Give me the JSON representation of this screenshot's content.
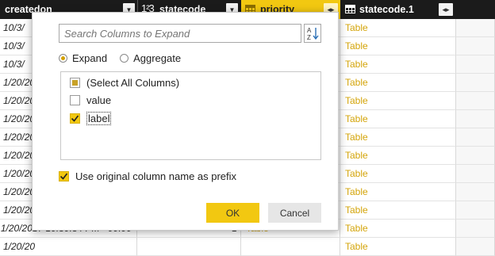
{
  "columns": {
    "createdon": "createdon",
    "statecode_type": "1²3",
    "statecode": "statecode",
    "priority": "priority",
    "statecode1": "statecode.1"
  },
  "rows": [
    {
      "date": "10/3/",
      "state": "",
      "priority": "",
      "statecode1": "Table"
    },
    {
      "date": "10/3/",
      "state": "",
      "priority": "",
      "statecode1": "Table"
    },
    {
      "date": "10/3/",
      "state": "",
      "priority": "",
      "statecode1": "Table"
    },
    {
      "date": "1/20/20",
      "state": "",
      "priority": "",
      "statecode1": "Table"
    },
    {
      "date": "1/20/20",
      "state": "",
      "priority": "",
      "statecode1": "Table"
    },
    {
      "date": "1/20/20",
      "state": "",
      "priority": "",
      "statecode1": "Table"
    },
    {
      "date": "1/20/20",
      "state": "",
      "priority": "",
      "statecode1": "Table"
    },
    {
      "date": "1/20/20",
      "state": "",
      "priority": "",
      "statecode1": "Table"
    },
    {
      "date": "1/20/20",
      "state": "",
      "priority": "",
      "statecode1": "Table"
    },
    {
      "date": "1/20/20",
      "state": "",
      "priority": "",
      "statecode1": "Table"
    },
    {
      "date": "1/20/20",
      "state": "",
      "priority": "",
      "statecode1": "Table"
    },
    {
      "date": "1/20/20",
      "state": "",
      "priority": "",
      "statecode1": "Table"
    },
    {
      "date": "1/20/2017 10:50:54 PM +00:00",
      "state": "1",
      "priority": "Table",
      "statecode1": "Table"
    }
  ],
  "dialog": {
    "search_placeholder": "Search Columns to Expand",
    "sort_icon": "sort-az-icon",
    "mode_expand": "Expand",
    "mode_aggregate": "Aggregate",
    "selected_mode": "Expand",
    "items": [
      {
        "label": "(Select All Columns)",
        "state": "partial"
      },
      {
        "label": "value",
        "state": "unchecked"
      },
      {
        "label": "label",
        "state": "checked"
      }
    ],
    "prefix_label": "Use original column name as prefix",
    "prefix_checked": true,
    "ok_label": "OK",
    "cancel_label": "Cancel"
  },
  "colors": {
    "accent": "#f2c811",
    "header_bg": "#1b1b1b",
    "table_link": "#d4a50a"
  }
}
